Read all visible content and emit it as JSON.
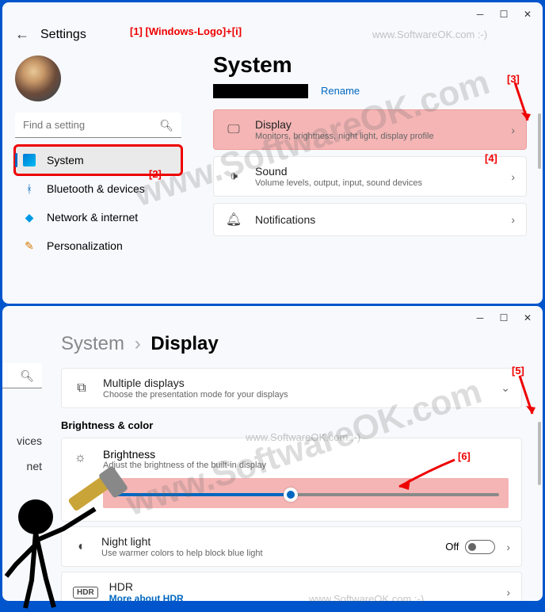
{
  "annotations": {
    "a1": "[1] [Windows-Logo]+[i]",
    "a2": "[2]",
    "a3": "[3]",
    "a4": "[4]",
    "a5": "[5]",
    "a6": "[6]"
  },
  "watermark_large": "www.SoftwareOK.com",
  "watermark_small": "www.SoftwareOK.com :-)",
  "window1": {
    "header": {
      "settings": "Settings"
    },
    "search": {
      "placeholder": "Find a setting"
    },
    "nav": {
      "system": "System",
      "bluetooth": "Bluetooth & devices",
      "network": "Network & internet",
      "personalization": "Personalization"
    },
    "main": {
      "title": "System",
      "rename": "Rename",
      "display": {
        "title": "Display",
        "sub": "Monitors, brightness, night light, display profile"
      },
      "sound": {
        "title": "Sound",
        "sub": "Volume levels, output, input, sound devices"
      },
      "notifications": {
        "title": "Notifications"
      }
    }
  },
  "window2": {
    "breadcrumb": {
      "system": "System",
      "display": "Display"
    },
    "truncated": {
      "vices": "vices",
      "net": "net"
    },
    "multi": {
      "title": "Multiple displays",
      "sub": "Choose the presentation mode for your displays"
    },
    "section": "Brightness & color",
    "brightness": {
      "title": "Brightness",
      "sub": "Adjust the brightness of the built-in display",
      "value": 46
    },
    "nightlight": {
      "title": "Night light",
      "sub": "Use warmer colors to help block blue light",
      "state": "Off"
    },
    "hdr": {
      "title": "HDR",
      "link": "More about HDR",
      "badge": "HDR"
    }
  }
}
